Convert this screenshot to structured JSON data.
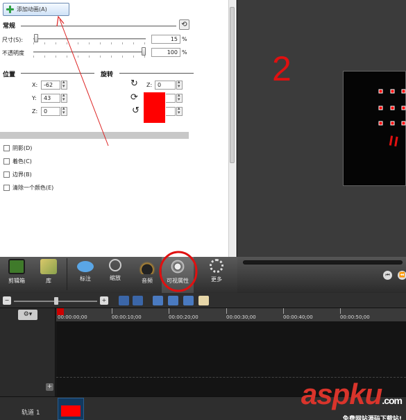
{
  "properties": {
    "add_animation": "添加动画(A)",
    "general_title": "常规",
    "size_label": "尺寸(S):",
    "size_value": "15",
    "size_fraction": 0.15,
    "opacity_label": "不透明度",
    "opacity_value": "100",
    "opacity_fraction": 1.0,
    "percent": "%",
    "position_title": "位置",
    "rotation_title": "旋转",
    "position": [
      {
        "axis": "X:",
        "value": "-62"
      },
      {
        "axis": "Y:",
        "value": "43"
      },
      {
        "axis": "Z:",
        "value": "0"
      }
    ],
    "rotation": [
      {
        "axis": "Z:",
        "value": "0"
      },
      {
        "axis": "X:",
        "value": "0"
      },
      {
        "axis": "Y:",
        "value": "0"
      }
    ],
    "checkboxes": [
      "阴影(D)",
      "着色(C)",
      "边界(B)",
      "清除一个颜色(E)"
    ]
  },
  "tools": [
    {
      "label": "剪辑箱",
      "icon": "film-icon"
    },
    {
      "label": "库",
      "icon": "library-icon"
    },
    {
      "label": "标注",
      "icon": "callout-icon"
    },
    {
      "label": "缩放",
      "icon": "zoom-icon"
    },
    {
      "label": "音频",
      "icon": "audio-icon"
    },
    {
      "label": "可视属性",
      "icon": "visual-properties-icon"
    },
    {
      "label": "更多",
      "icon": "more-icon"
    }
  ],
  "timeline": {
    "ticks": [
      "00:00:00;00",
      "00:00:10;00",
      "00:00:20;00",
      "00:00:30;00",
      "00:00:40;00",
      "00:00:50;00"
    ],
    "track_label": "轨道 1"
  },
  "annotations": {
    "marker_two": "2",
    "marker_equals": "=",
    "watermark": "aspku",
    "watermark_suffix": ".com",
    "watermark_sub": "免费网站源码下载站!"
  },
  "colors": {
    "annotation_red": "#e01010",
    "accent_red": "#ff0000",
    "clip_blue": "#12395e"
  }
}
